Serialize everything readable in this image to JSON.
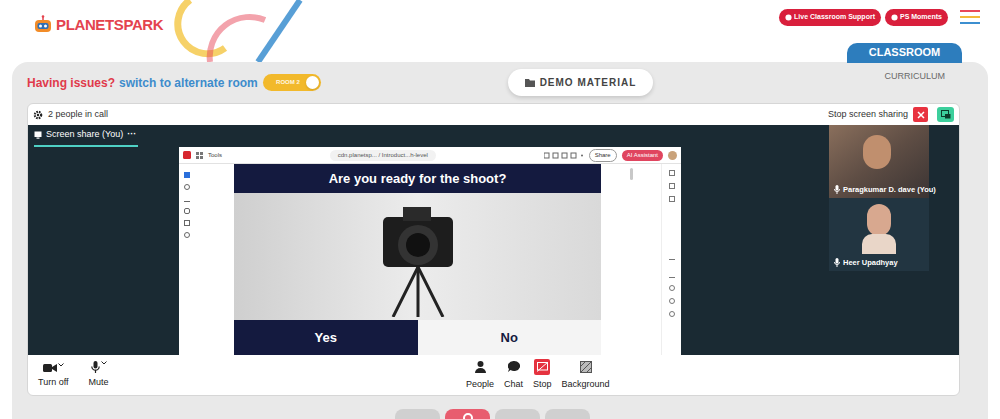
{
  "header": {
    "logo": "PLANETSPARK",
    "buttons": [
      {
        "label": "Live Classroom Support"
      },
      {
        "label": "PS Moments"
      }
    ]
  },
  "tabs": [
    {
      "label": "CLASSROOM",
      "selected": true
    },
    {
      "label": "CURRICULUM",
      "selected": false
    }
  ],
  "room_switch": {
    "issue": "Having issues?",
    "action": "switch to alternate room",
    "toggle_label": "ROOM 2",
    "on": true
  },
  "material_button": "DEMO MATERIAL",
  "call": {
    "people": "2 people in call",
    "stop_sharing": "Stop screen sharing",
    "screen_tab": "Screen share (You)",
    "tab_more": "···"
  },
  "viewer": {
    "tools": "Tools",
    "address": "cdn.planetsp... / Introduct...h-level",
    "share": "Share",
    "assistant": "AI Assistant"
  },
  "slide": {
    "title": "Are you ready for the shoot?",
    "options": [
      {
        "label": "Yes",
        "color": "#141a3f"
      },
      {
        "label": "No",
        "color": "#f4f4f4"
      }
    ]
  },
  "participants": [
    {
      "name": "Paragkumar D. dave (You)",
      "muted": false
    },
    {
      "name": "Heer Upadhyay",
      "muted": false
    }
  ],
  "controls": {
    "left": [
      {
        "label": "Turn off"
      },
      {
        "label": "Mute"
      }
    ],
    "center": [
      {
        "label": "People",
        "active": false
      },
      {
        "label": "Chat",
        "active": false
      },
      {
        "label": "Stop",
        "active": true
      },
      {
        "label": "Background",
        "active": false
      }
    ]
  }
}
